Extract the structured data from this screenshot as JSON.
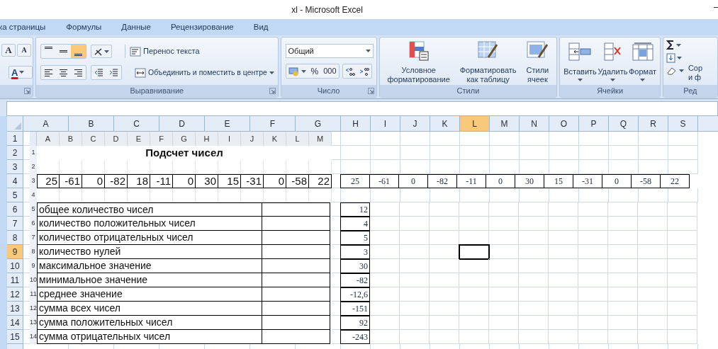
{
  "window": {
    "title": "xl - Microsoft Excel"
  },
  "ribbon_tabs": [
    "ка страницы",
    "Формулы",
    "Данные",
    "Рецензирование",
    "Вид"
  ],
  "font_group": {
    "grow": "A",
    "shrink": "A",
    "font_color_label": "A"
  },
  "alignment": {
    "label": "Выравнивание",
    "vertical": [
      {
        "kind": "top",
        "selected": false
      },
      {
        "kind": "middle",
        "selected": false
      },
      {
        "kind": "bottom",
        "selected": true
      }
    ],
    "wrap_text": "Перенос текста",
    "merge": "Объединить и поместить в центре"
  },
  "number": {
    "label": "Число",
    "format": "Общий",
    "percent": "%",
    "thousands": "000"
  },
  "styles": {
    "label": "Стили",
    "buttons": [
      {
        "kind": "conditional",
        "label": "Условное\nформатирование"
      },
      {
        "kind": "table",
        "label": "Форматировать\nкак таблицу"
      },
      {
        "kind": "cell",
        "label": "Стили\nячеек"
      }
    ]
  },
  "cells": {
    "label": "Ячейки",
    "buttons": [
      {
        "kind": "insert",
        "label": "Вставить"
      },
      {
        "kind": "delete",
        "label": "Удалить"
      },
      {
        "kind": "format",
        "label": "Формат"
      }
    ]
  },
  "editing": {
    "label": "Ред",
    "sort": "Сор\nи ф"
  },
  "sheet": {
    "columns": [
      {
        "label": "A",
        "selected": false
      },
      {
        "label": "B",
        "selected": false
      },
      {
        "label": "C",
        "selected": false
      },
      {
        "label": "D",
        "selected": false
      },
      {
        "label": "E",
        "selected": false
      },
      {
        "label": "F",
        "selected": false
      },
      {
        "label": "G",
        "selected": false
      },
      {
        "label": "H",
        "selected": false
      },
      {
        "label": "I",
        "selected": false
      },
      {
        "label": "J",
        "selected": false
      },
      {
        "label": "K",
        "selected": false
      },
      {
        "label": "L",
        "selected": true
      },
      {
        "label": "M",
        "selected": false
      },
      {
        "label": "N",
        "selected": false
      },
      {
        "label": "O",
        "selected": false
      },
      {
        "label": "P",
        "selected": false
      },
      {
        "label": "Q",
        "selected": false
      },
      {
        "label": "R",
        "selected": false
      },
      {
        "label": "S",
        "selected": false
      }
    ],
    "rows": [
      {
        "label": "1",
        "selected": false
      },
      {
        "label": "2",
        "selected": false
      },
      {
        "label": "3",
        "selected": false
      },
      {
        "label": "4",
        "selected": false
      },
      {
        "label": "5",
        "selected": false
      },
      {
        "label": "6",
        "selected": false
      },
      {
        "label": "7",
        "selected": false
      },
      {
        "label": "8",
        "selected": false
      },
      {
        "label": "9",
        "selected": true
      },
      {
        "label": "10",
        "selected": false
      },
      {
        "label": "11",
        "selected": false
      },
      {
        "label": "12",
        "selected": false
      },
      {
        "label": "13",
        "selected": false
      },
      {
        "label": "14",
        "selected": false
      },
      {
        "label": "15",
        "selected": false
      }
    ],
    "row4_values": [
      "25",
      "-61",
      "0",
      "-82",
      "-11",
      "0",
      "30",
      "15",
      "-31",
      "0",
      "-58",
      "22"
    ],
    "column_h_results": [
      "12",
      "4",
      "5",
      "3",
      "30",
      "-82",
      "-12,6",
      "-151",
      "92",
      "-243"
    ]
  },
  "embedded_sheet": {
    "columns": [
      "A",
      "B",
      "C",
      "D",
      "E",
      "F",
      "G",
      "H",
      "I",
      "J",
      "K",
      "L",
      "M"
    ],
    "rows": [
      "1",
      "2",
      "3",
      "4",
      "5",
      "6",
      "7",
      "8",
      "9",
      "10",
      "11",
      "12",
      "13",
      "14"
    ],
    "title": "Подсчет чисел",
    "numbers": [
      "25",
      "-61",
      "0",
      "-82",
      "18",
      "-11",
      "0",
      "30",
      "15",
      "-31",
      "0",
      "-58",
      "22"
    ],
    "labels": [
      "общее количество чисел",
      "количество положительных чисел",
      "количество отрицательных чисел",
      "количество нулей",
      "максимальное значение",
      "минимальное значение",
      "среднее значение",
      "сумма всех чисел",
      "сумма положительных чисел",
      "сумма отрицательных чисел"
    ]
  }
}
